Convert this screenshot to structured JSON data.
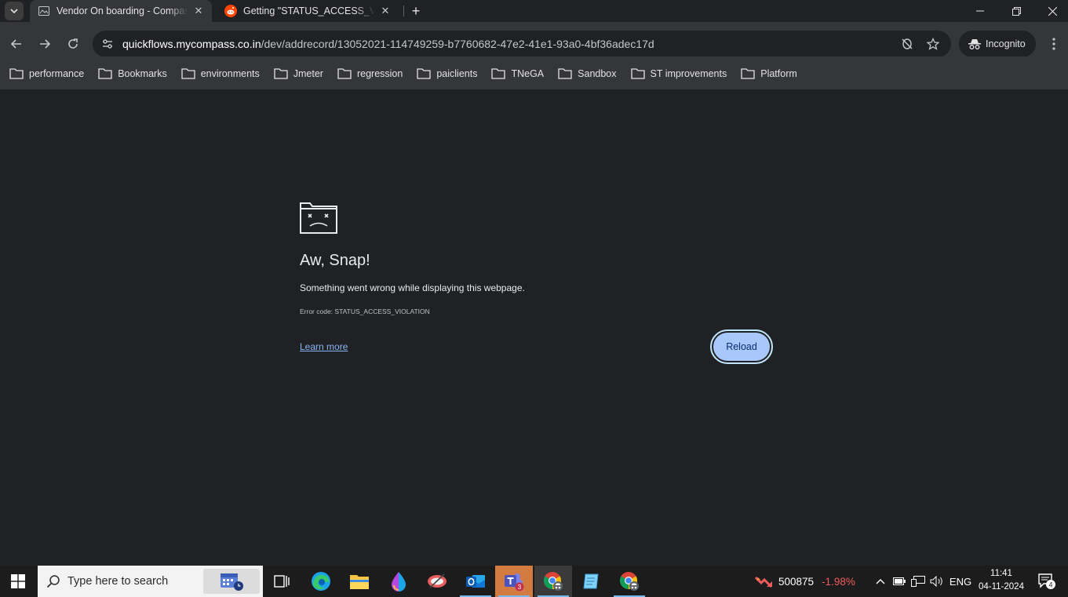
{
  "browser": {
    "tabs": [
      {
        "title": "Vendor On boarding - Compass",
        "favicon": "page-icon",
        "active": true
      },
      {
        "title": "Getting \"STATUS_ACCESS_VIOLATION\"",
        "favicon": "reddit-icon",
        "active": false
      }
    ],
    "url": {
      "host": "quickflows.mycompass.co.in",
      "path": "/dev/addrecord/13052021-114749259-b7760682-47e2-41e1-93a0-4bf36adec17d"
    },
    "profile_label": "Incognito",
    "bookmarks": [
      "performance",
      "Bookmarks",
      "environments",
      "Jmeter",
      "regression",
      "paiclients",
      "TNeGA",
      "Sandbox",
      "ST improvements",
      "Platform"
    ]
  },
  "error_page": {
    "heading": "Aw, Snap!",
    "message": "Something went wrong while displaying this webpage.",
    "error_code": "Error code: STATUS_ACCESS_VIOLATION",
    "learn_more": "Learn more",
    "reload": "Reload"
  },
  "taskbar": {
    "search_placeholder": "Type here to search",
    "teams_badge": "3",
    "stock_value": "500875",
    "stock_change": "-1.98%",
    "language": "ENG",
    "time": "11:41",
    "date": "04-11-2024",
    "notification_count": "4"
  },
  "colors": {
    "page_bg": "#202124",
    "toolbar_bg": "#35363a",
    "link": "#8ab4f8",
    "reload_bg": "#a8c7fa",
    "stock_down": "#f15c5c"
  }
}
